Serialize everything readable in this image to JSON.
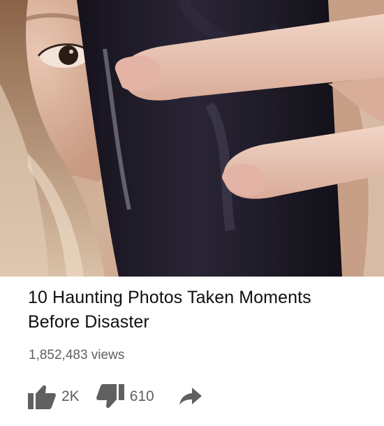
{
  "video": {
    "title": "10 Haunting Photos Taken Moments Before Disaster",
    "views": "1,852,483 views"
  },
  "actions": {
    "like_count": "2K",
    "dislike_count": "610"
  },
  "icons": {
    "like": "thumbs-up-icon",
    "dislike": "thumbs-down-icon",
    "share": "share-arrow-icon"
  },
  "colors": {
    "title": "#0f0f0f",
    "meta": "#606060",
    "icon": "#606060",
    "background": "#ffffff"
  }
}
